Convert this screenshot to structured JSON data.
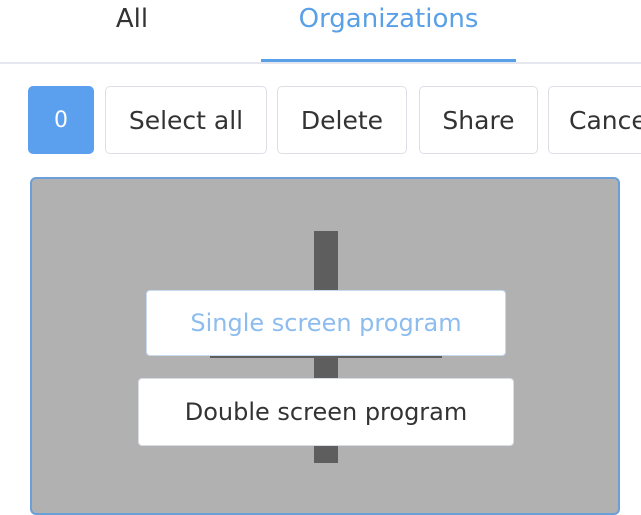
{
  "tabs": {
    "all_label": "All",
    "organizations_label": "Organizations",
    "active": "Organizations"
  },
  "toolbar": {
    "selected_count": "0",
    "select_all_label": "Select all",
    "delete_label": "Delete",
    "share_label": "Share",
    "cancel_label": "Cancel"
  },
  "program_menu": {
    "single_screen_label": "Single screen program",
    "double_screen_label": "Double screen program"
  },
  "colors": {
    "accent": "#5aa0ee",
    "card_background": "#b1b1b1",
    "card_border": "#6a9fd8",
    "placeholder_shape": "#5e5e5e",
    "hover_text": "#8dbcee"
  }
}
